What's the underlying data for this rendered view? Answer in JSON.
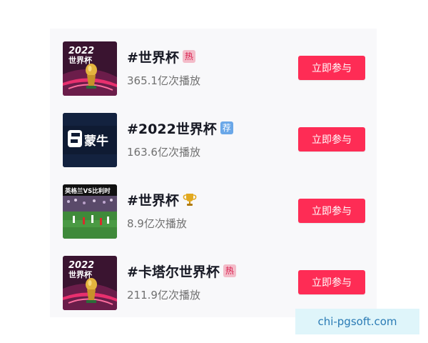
{
  "topics": [
    {
      "title": "#世界杯",
      "badge": "热",
      "badge_type": "hot",
      "plays": "365.1亿次播放",
      "thumb_icon": "world-cup-2022-poster-icon",
      "thumb_text_top": "2022",
      "thumb_text_bottom": "世界杯",
      "join_label": "立即参与"
    },
    {
      "title": "#2022世界杯",
      "badge": "荐",
      "badge_type": "recommend",
      "plays": "163.6亿次播放",
      "thumb_icon": "mengniu-logo-icon",
      "thumb_text_top": "蒙牛",
      "join_label": "立即参与"
    },
    {
      "title": "#世界杯",
      "badge_type": "trophy",
      "badge_icon": "trophy-icon",
      "plays": "8.9亿次播放",
      "thumb_icon": "football-match-photo-icon",
      "thumb_text_top": "英格兰VS比利时",
      "join_label": "立即参与"
    },
    {
      "title": "#卡塔尔世界杯",
      "badge": "热",
      "badge_type": "hot",
      "plays": "211.9亿次播放",
      "thumb_icon": "world-cup-2022-poster-icon",
      "thumb_text_top": "2022",
      "thumb_text_bottom": "世界杯",
      "join_label": "立即参与"
    }
  ],
  "watermark": "chi-pgsoft.com",
  "colors": {
    "accent": "#fe2c55",
    "hot_badge_bg": "#f3bcc9",
    "hot_badge_text": "#d81e4d",
    "recommend_badge_bg": "#6aa7e8",
    "poster_bg": "#3a1430",
    "poster_pink": "#e8306e",
    "mengniu_bg": "#0f1b33",
    "text_primary": "#161823",
    "text_secondary": "#707070"
  }
}
